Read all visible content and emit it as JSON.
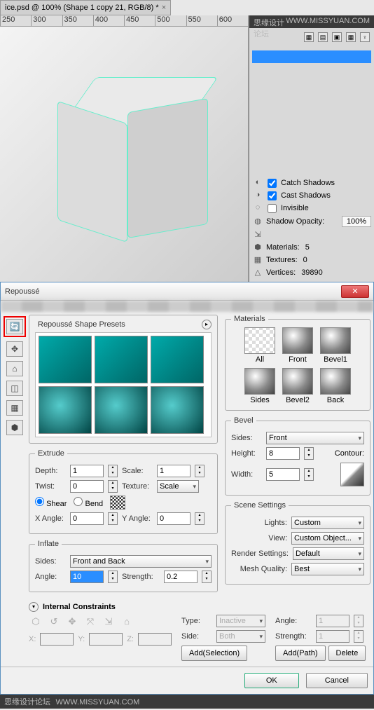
{
  "tab": {
    "title": "ice.psd @ 100% (Shape 1 copy 21, RGB/8) *"
  },
  "corner": {
    "label": "思缘设计论坛",
    "url": "WWW.MISSYUAN.COM"
  },
  "ruler": [
    "250",
    "300",
    "350",
    "400",
    "450",
    "500",
    "550",
    "600"
  ],
  "panel": {
    "catch_shadows": "Catch Shadows",
    "cast_shadows": "Cast Shadows",
    "invisible": "Invisible",
    "shadow_opacity": "Shadow Opacity:",
    "shadow_opacity_val": "100%",
    "materials": "Materials:",
    "materials_val": "5",
    "textures": "Textures:",
    "textures_val": "0",
    "vertices": "Vertices:",
    "vertices_val": "39890"
  },
  "dialog": {
    "title": "Repoussé",
    "presets_title": "Repoussé Shape Presets",
    "materials_title": "Materials",
    "mat": {
      "all": "All",
      "front": "Front",
      "bevel1": "Bevel1",
      "sides": "Sides",
      "bevel2": "Bevel2",
      "back": "Back"
    },
    "extrude": {
      "title": "Extrude",
      "depth": "Depth:",
      "depth_val": "1",
      "scale": "Scale:",
      "scale_val": "1",
      "twist": "Twist:",
      "twist_val": "0",
      "texture": "Texture:",
      "texture_val": "Scale",
      "shear": "Shear",
      "bend": "Bend",
      "xangle": "X Angle:",
      "xangle_val": "0",
      "yangle": "Y Angle:",
      "yangle_val": "0"
    },
    "bevel": {
      "title": "Bevel",
      "sides": "Sides:",
      "sides_val": "Front",
      "height": "Height:",
      "height_val": "8",
      "width": "Width:",
      "width_val": "5",
      "contour": "Contour:"
    },
    "scene": {
      "title": "Scene Settings",
      "lights": "Lights:",
      "lights_val": "Custom",
      "view": "View:",
      "view_val": "Custom Object...",
      "render": "Render Settings:",
      "render_val": "Default",
      "mesh": "Mesh Quality:",
      "mesh_val": "Best"
    },
    "inflate": {
      "title": "Inflate",
      "sides": "Sides:",
      "sides_val": "Front and Back",
      "angle": "Angle:",
      "angle_val": "10",
      "strength": "Strength:",
      "strength_val": "0.2"
    },
    "internal": {
      "title": "Internal Constraints",
      "type": "Type:",
      "type_val": "Inactive",
      "side": "Side:",
      "side_val": "Both",
      "angle": "Angle:",
      "angle_val": "1",
      "strength": "Strength:",
      "strength_val": "1",
      "x": "X:",
      "y": "Y:",
      "z": "Z:",
      "add_sel": "Add(Selection)",
      "add_path": "Add(Path)",
      "delete": "Delete"
    },
    "ok": "OK",
    "cancel": "Cancel"
  },
  "wm": {
    "label": "思缘设计论坛",
    "url": "WWW.MISSYUAN.COM"
  }
}
